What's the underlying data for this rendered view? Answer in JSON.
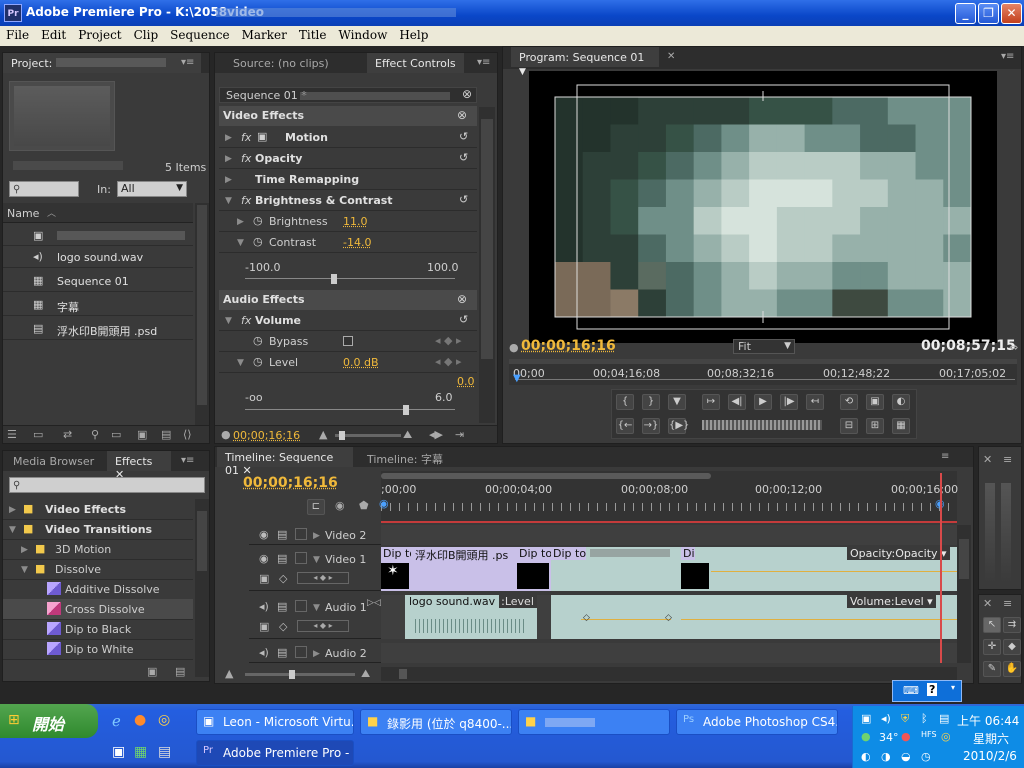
{
  "window": {
    "title": "Adobe Premiere Pro - K:\\2058video",
    "app_icon": "Pr"
  },
  "menu": [
    "File",
    "Edit",
    "Project",
    "Clip",
    "Sequence",
    "Marker",
    "Title",
    "Window",
    "Help"
  ],
  "project_panel": {
    "tab_label": "Project:",
    "items_count": "5 Items",
    "in_label": "In:",
    "in_value": "All",
    "column_name": "Name",
    "items": [
      {
        "name": "",
        "icon": "video-clip-icon"
      },
      {
        "name": "logo sound.wav",
        "icon": "audio-file-icon"
      },
      {
        "name": "Sequence 01",
        "icon": "sequence-icon"
      },
      {
        "name": "字幕",
        "icon": "title-icon"
      },
      {
        "name": "浮水印B開頭用 .psd",
        "icon": "psd-file-icon"
      }
    ]
  },
  "effect_controls": {
    "source_tab": "Source: (no clips)",
    "tab_label": "Effect Controls",
    "sequence_label": "Sequence 01 *",
    "video_effects_header": "Video Effects",
    "motion": "Motion",
    "opacity": "Opacity",
    "time_remapping": "Time Remapping",
    "brightness_contrast": "Brightness & Contrast",
    "brightness_label": "Brightness",
    "brightness_value": "11.0",
    "contrast_label": "Contrast",
    "contrast_value": "-14.0",
    "slider_min": "-100.0",
    "slider_max": "100.0",
    "audio_effects_header": "Audio Effects",
    "volume": "Volume",
    "bypass_label": "Bypass",
    "level_label": "Level",
    "level_value": "0.0 dB",
    "level_readout": "0.0",
    "level_min": "-oo",
    "level_max": "6.0",
    "timecode": "00;00;16;16"
  },
  "program_monitor": {
    "tab_label": "Program: Sequence 01",
    "current_timecode": "00;00;16;16",
    "fit_label": "Fit",
    "duration": "00;08;57;15",
    "ruler": [
      "00;00",
      "00;04;16;08",
      "00;08;32;16",
      "00;12;48;22",
      "00;17;05;02"
    ]
  },
  "effects_panel": {
    "media_browser_tab": "Media Browser",
    "effects_tab": "Effects",
    "tree": [
      {
        "label": "Video Effects",
        "level": 0,
        "bold": true
      },
      {
        "label": "Video Transitions",
        "level": 0,
        "bold": true
      },
      {
        "label": "3D Motion",
        "level": 1
      },
      {
        "label": "Dissolve",
        "level": 1
      },
      {
        "label": "Additive Dissolve",
        "level": 2
      },
      {
        "label": "Cross Dissolve",
        "level": 2
      },
      {
        "label": "Dip to Black",
        "level": 2
      },
      {
        "label": "Dip to White",
        "level": 2
      }
    ]
  },
  "timeline": {
    "tab_active": "Timeline: Sequence 01",
    "tab_other": "Timeline: 字幕",
    "timecode": "00;00;16;16",
    "ruler": [
      ";00;00",
      "00;00;04;00",
      "00;00;08;00",
      "00;00;12;00",
      "00;00;16;00"
    ],
    "tracks": [
      "Video 2",
      "Video 1",
      "Audio 1",
      "Audio 2"
    ],
    "video1_clips": [
      "Dip to",
      "浮水印B開頭用 .ps",
      "Dip to",
      "Dip to",
      "Di"
    ],
    "opacity_label": "Opacity:Opacity",
    "audio_clip": "logo sound.wav",
    "audio_level": ":Level",
    "volume_label": "Volume:Level"
  },
  "taskbar": {
    "start_label": "開始",
    "row1": [
      "Leon - Microsoft Virtu...",
      "錄影用 (位於 q8400-...",
      "",
      "Adobe Photoshop CS4..."
    ],
    "row2": [
      "Adobe Premiere Pro - ..."
    ],
    "clock": "上午 06:44",
    "weekday": "星期六",
    "date": "2010/2/6",
    "temp": "34°"
  }
}
